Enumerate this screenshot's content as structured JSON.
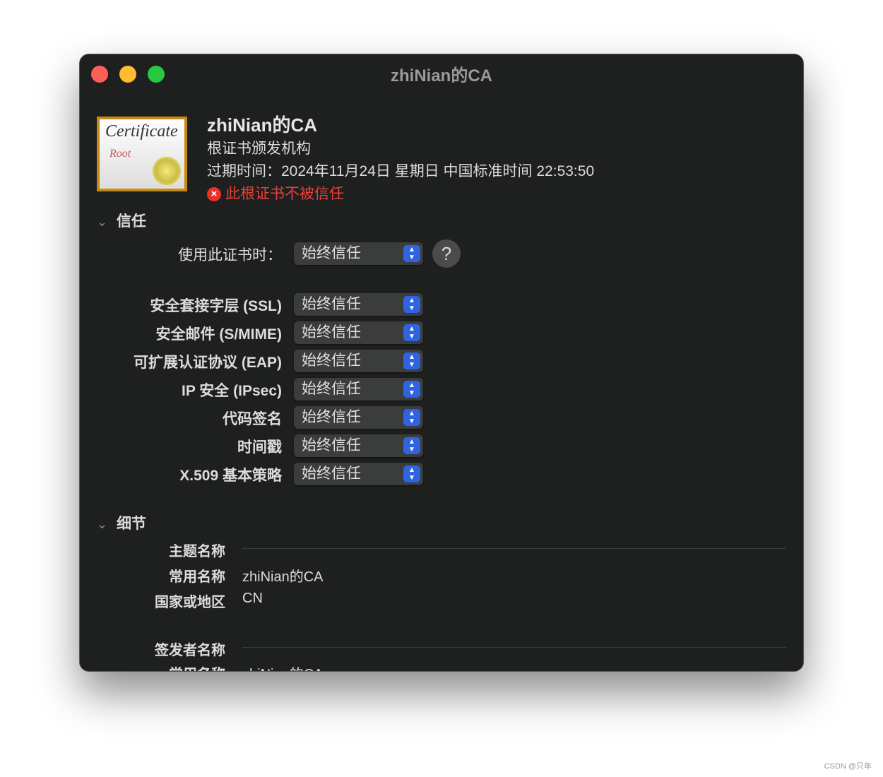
{
  "window": {
    "title": "zhiNian的CA",
    "colors": {
      "close": "#fe5f57",
      "minimize": "#febc2e",
      "zoom": "#28c840"
    }
  },
  "header": {
    "cert_image_text": "Certificate Root",
    "name": "zhiNian的CA",
    "kind": "根证书颁发机构",
    "expires": "过期时间：2024年11月24日 星期日 中国标准时间 22:53:50",
    "status": "此根证书不被信任",
    "status_color": "#e8423a"
  },
  "trust": {
    "section": "信任",
    "when_using_label": "使用此证书时：",
    "when_using_value": "始终信任",
    "help": "?",
    "rows": [
      {
        "label": "安全套接字层 (SSL)",
        "value": "始终信任"
      },
      {
        "label": "安全邮件 (S/MIME)",
        "value": "始终信任"
      },
      {
        "label": "可扩展认证协议 (EAP)",
        "value": "始终信任"
      },
      {
        "label": "IP 安全 (IPsec)",
        "value": "始终信任"
      },
      {
        "label": "代码签名",
        "value": "始终信任"
      },
      {
        "label": "时间戳",
        "value": "始终信任"
      },
      {
        "label": "X.509 基本策略",
        "value": "始终信任"
      }
    ]
  },
  "details": {
    "section": "细节",
    "subject_heading": "主题名称",
    "subject": [
      {
        "label": "常用名称",
        "value": "zhiNian的CA"
      },
      {
        "label": "国家或地区",
        "value": "CN"
      }
    ],
    "issuer_heading": "签发者名称",
    "issuer": [
      {
        "label": "常用名称",
        "value": "zhiNian的CA"
      }
    ]
  },
  "watermark": "CSDN @只年"
}
